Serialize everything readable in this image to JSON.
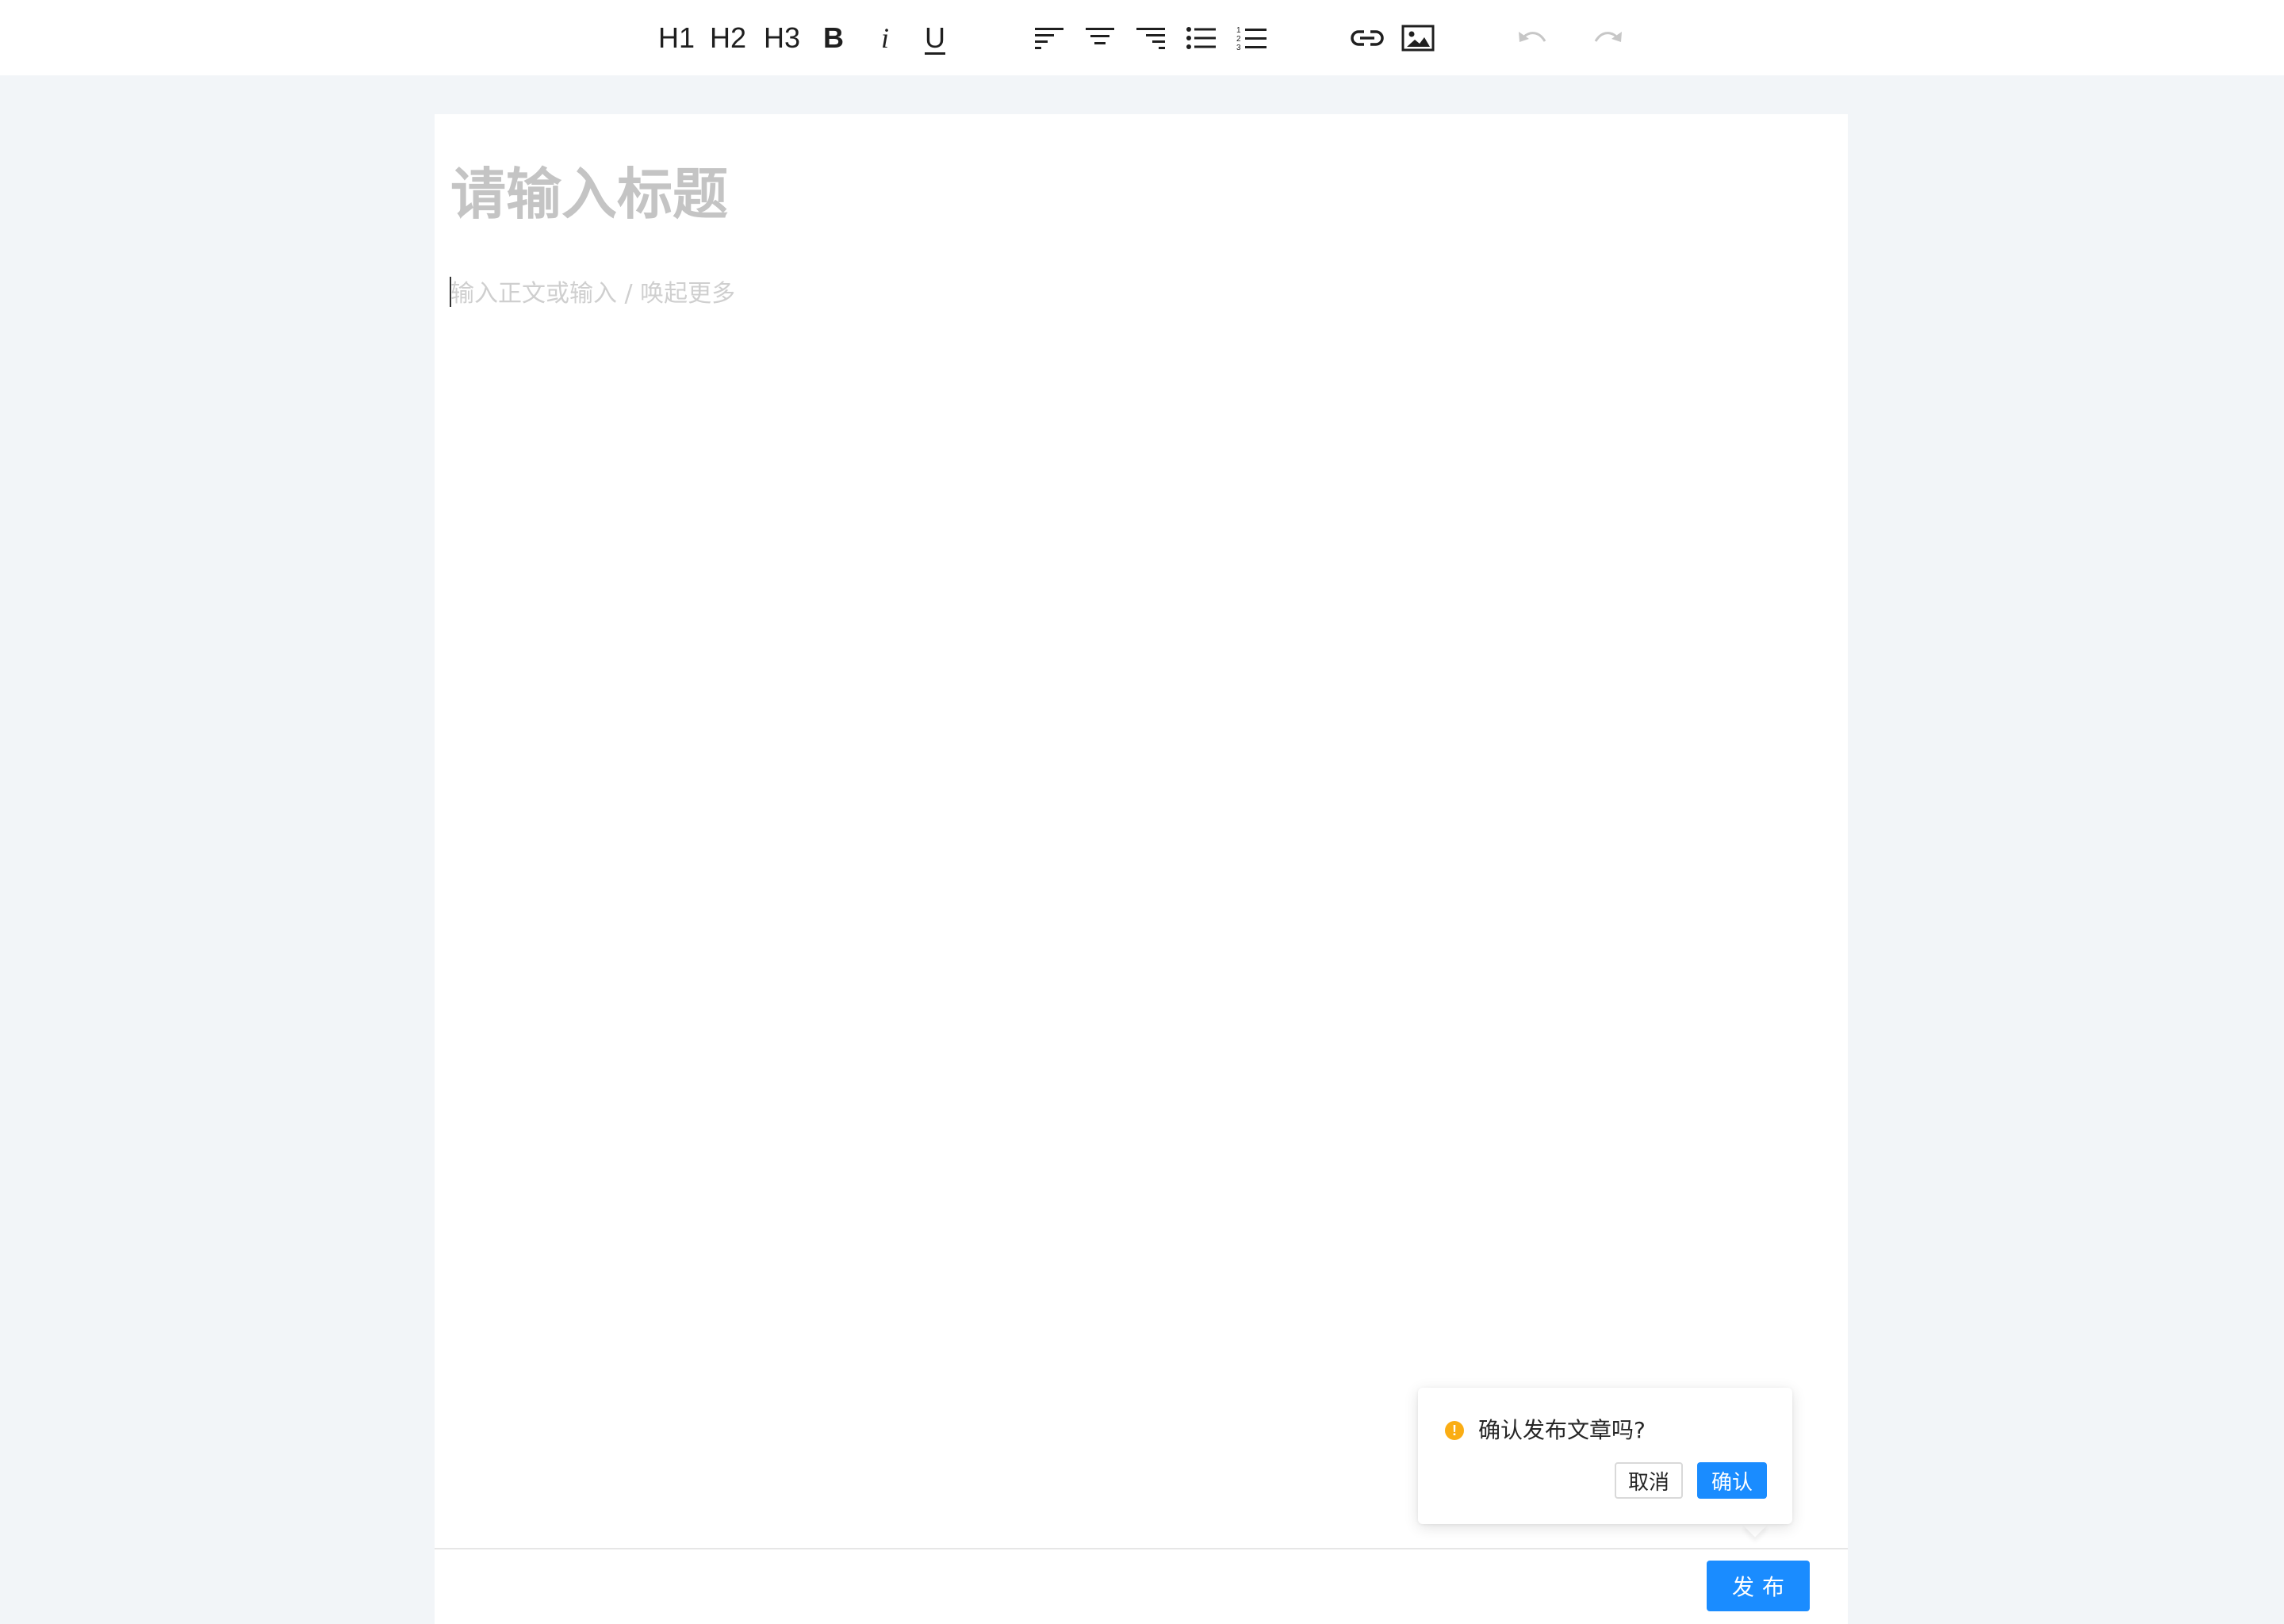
{
  "toolbar": {
    "h1": "H1",
    "h2": "H2",
    "h3": "H3",
    "bold": "B",
    "italic": "i",
    "underline": "U",
    "icons": [
      "align-left-icon",
      "align-center-icon",
      "align-right-icon",
      "bullet-list-icon",
      "numbered-list-icon",
      "link-icon",
      "image-icon",
      "undo-icon",
      "redo-icon"
    ]
  },
  "editor": {
    "title_placeholder": "请输入标题",
    "body_placeholder": "输入正文或输入 / 唤起更多"
  },
  "popconfirm": {
    "message": "确认发布文章吗?",
    "cancel_label": "取消",
    "ok_label": "确认",
    "icon": "exclamation-circle-icon",
    "icon_color": "#faad14"
  },
  "footer": {
    "publish_label": "发布"
  },
  "colors": {
    "primary": "#1a8cff",
    "background": "#f2f5f8"
  }
}
